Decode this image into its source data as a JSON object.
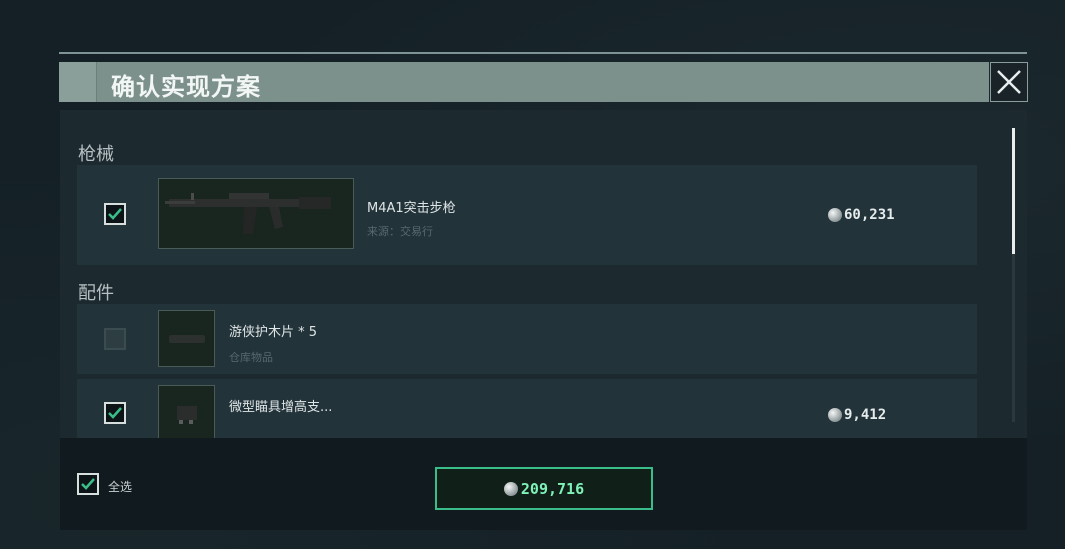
{
  "dialog": {
    "title": "确认实现方案",
    "close_icon": "close-icon"
  },
  "sections": {
    "guns_label": "枪械",
    "parts_label": "配件"
  },
  "items": [
    {
      "name": "M4A1突击步枪",
      "source": "来源：交易行",
      "price": "60,231",
      "checked": true
    },
    {
      "name": "游侠护木片 * 5",
      "source": "仓库物品",
      "price": "",
      "checked": false
    },
    {
      "name": "微型瞄具增高支...",
      "source": "",
      "price": "9,412",
      "checked": true
    }
  ],
  "footer": {
    "select_all_label": "全选",
    "select_all_checked": true,
    "total_price": "209,716"
  },
  "colors": {
    "accent_green": "#3bbd8a",
    "total_text": "#7ff2b8",
    "title_bar": "#7d918c"
  }
}
